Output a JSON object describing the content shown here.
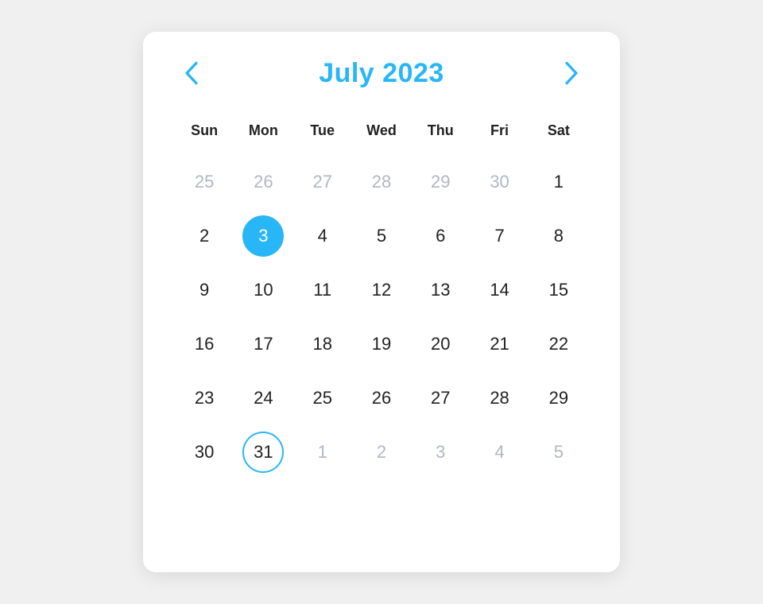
{
  "calendar": {
    "title": "July 2023",
    "prev_label": "‹",
    "next_label": "›",
    "weekdays": [
      "Sun",
      "Mon",
      "Tue",
      "Wed",
      "Thu",
      "Fri",
      "Sat"
    ],
    "weeks": [
      [
        {
          "day": "25",
          "type": "other-month"
        },
        {
          "day": "26",
          "type": "other-month"
        },
        {
          "day": "27",
          "type": "other-month"
        },
        {
          "day": "28",
          "type": "other-month"
        },
        {
          "day": "29",
          "type": "other-month"
        },
        {
          "day": "30",
          "type": "other-month"
        },
        {
          "day": "1",
          "type": "normal"
        }
      ],
      [
        {
          "day": "2",
          "type": "normal"
        },
        {
          "day": "3",
          "type": "selected"
        },
        {
          "day": "4",
          "type": "normal"
        },
        {
          "day": "5",
          "type": "normal"
        },
        {
          "day": "6",
          "type": "normal"
        },
        {
          "day": "7",
          "type": "normal"
        },
        {
          "day": "8",
          "type": "normal"
        }
      ],
      [
        {
          "day": "9",
          "type": "normal"
        },
        {
          "day": "10",
          "type": "normal"
        },
        {
          "day": "11",
          "type": "normal"
        },
        {
          "day": "12",
          "type": "normal"
        },
        {
          "day": "13",
          "type": "normal"
        },
        {
          "day": "14",
          "type": "normal"
        },
        {
          "day": "15",
          "type": "normal"
        }
      ],
      [
        {
          "day": "16",
          "type": "normal"
        },
        {
          "day": "17",
          "type": "normal"
        },
        {
          "day": "18",
          "type": "normal"
        },
        {
          "day": "19",
          "type": "normal"
        },
        {
          "day": "20",
          "type": "normal"
        },
        {
          "day": "21",
          "type": "normal"
        },
        {
          "day": "22",
          "type": "normal"
        }
      ],
      [
        {
          "day": "23",
          "type": "normal"
        },
        {
          "day": "24",
          "type": "normal"
        },
        {
          "day": "25",
          "type": "normal"
        },
        {
          "day": "26",
          "type": "normal"
        },
        {
          "day": "27",
          "type": "normal"
        },
        {
          "day": "28",
          "type": "normal"
        },
        {
          "day": "29",
          "type": "normal"
        }
      ],
      [
        {
          "day": "30",
          "type": "normal"
        },
        {
          "day": "31",
          "type": "today-outline"
        },
        {
          "day": "1",
          "type": "other-month"
        },
        {
          "day": "2",
          "type": "other-month"
        },
        {
          "day": "3",
          "type": "other-month"
        },
        {
          "day": "4",
          "type": "other-month"
        },
        {
          "day": "5",
          "type": "other-month"
        }
      ]
    ],
    "accent_color": "#29b6f6"
  }
}
